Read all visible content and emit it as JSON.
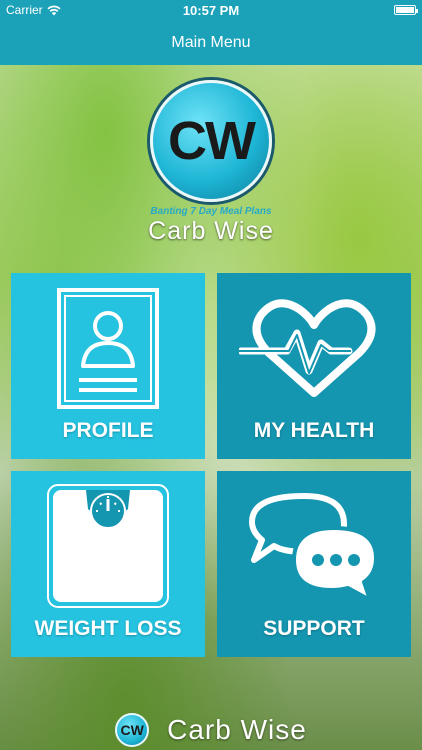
{
  "status_bar": {
    "carrier": "Carrier",
    "time": "10:57 PM"
  },
  "nav": {
    "title": "Main Menu"
  },
  "logo": {
    "initials": "CW",
    "tagline": "Banting 7 Day Meal Plans",
    "brand": "Carb Wise"
  },
  "tiles": [
    {
      "label": "PROFILE",
      "icon": "profile-card-icon"
    },
    {
      "label": "MY HEALTH",
      "icon": "heart-pulse-icon"
    },
    {
      "label": "WEIGHT LOSS",
      "icon": "scale-icon"
    },
    {
      "label": "SUPPORT",
      "icon": "chat-bubbles-icon"
    }
  ],
  "footer": {
    "initials": "CW",
    "brand": "Carb Wise"
  },
  "colors": {
    "accent": "#1ba1b8",
    "tile_light": "#25c3e0",
    "tile_dark": "#1596b0"
  }
}
